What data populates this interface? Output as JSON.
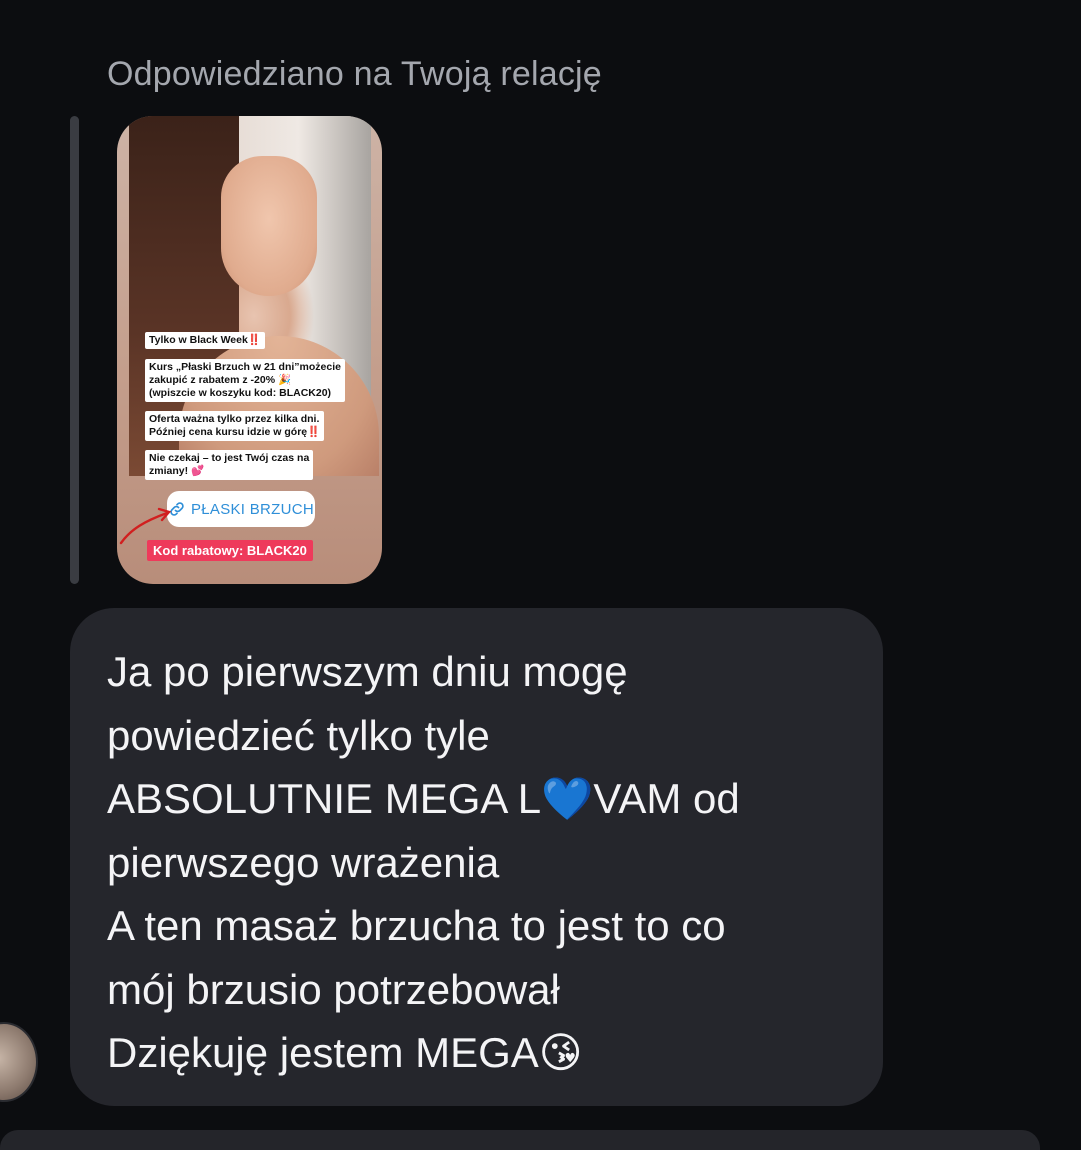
{
  "reply_label": "Odpowiedziano na Twoją relację",
  "story": {
    "tag1": "Tylko w Black Week‼️",
    "tag2": "Kurs „Płaski Brzuch w 21 dni”możecie\nzakupić z rabatem z -20% 🎉\n(wpiszcie w koszyku kod: BLACK20)",
    "tag3": "Oferta ważna tylko przez kilka dni.\nPóźniej cena kursu idzie w górę‼️",
    "tag4": "Nie czekaj – to jest Twój czas na\nzmiany! 💕",
    "link_label": "PŁASKI BRZUCH",
    "code_badge": "Kod rabatowy: BLACK20"
  },
  "message": {
    "lines": [
      "Ja po pierwszym dniu mogę",
      "powiedzieć tylko tyle",
      "ABSOLUTNIE MEGA L💙VAM  od",
      "pierwszego wrażenia",
      "A ten masaż brzucha to jest to co",
      "mój brzusio potrzebował",
      "Dziękuję jestem MEGA😘"
    ]
  },
  "colors": {
    "background": "#0c0d10",
    "bubble": "#25262c",
    "link": "#2f8fd8",
    "code_badge": "#ee3a5b"
  },
  "icons": [
    "link-icon",
    "red-arrow-icon"
  ]
}
